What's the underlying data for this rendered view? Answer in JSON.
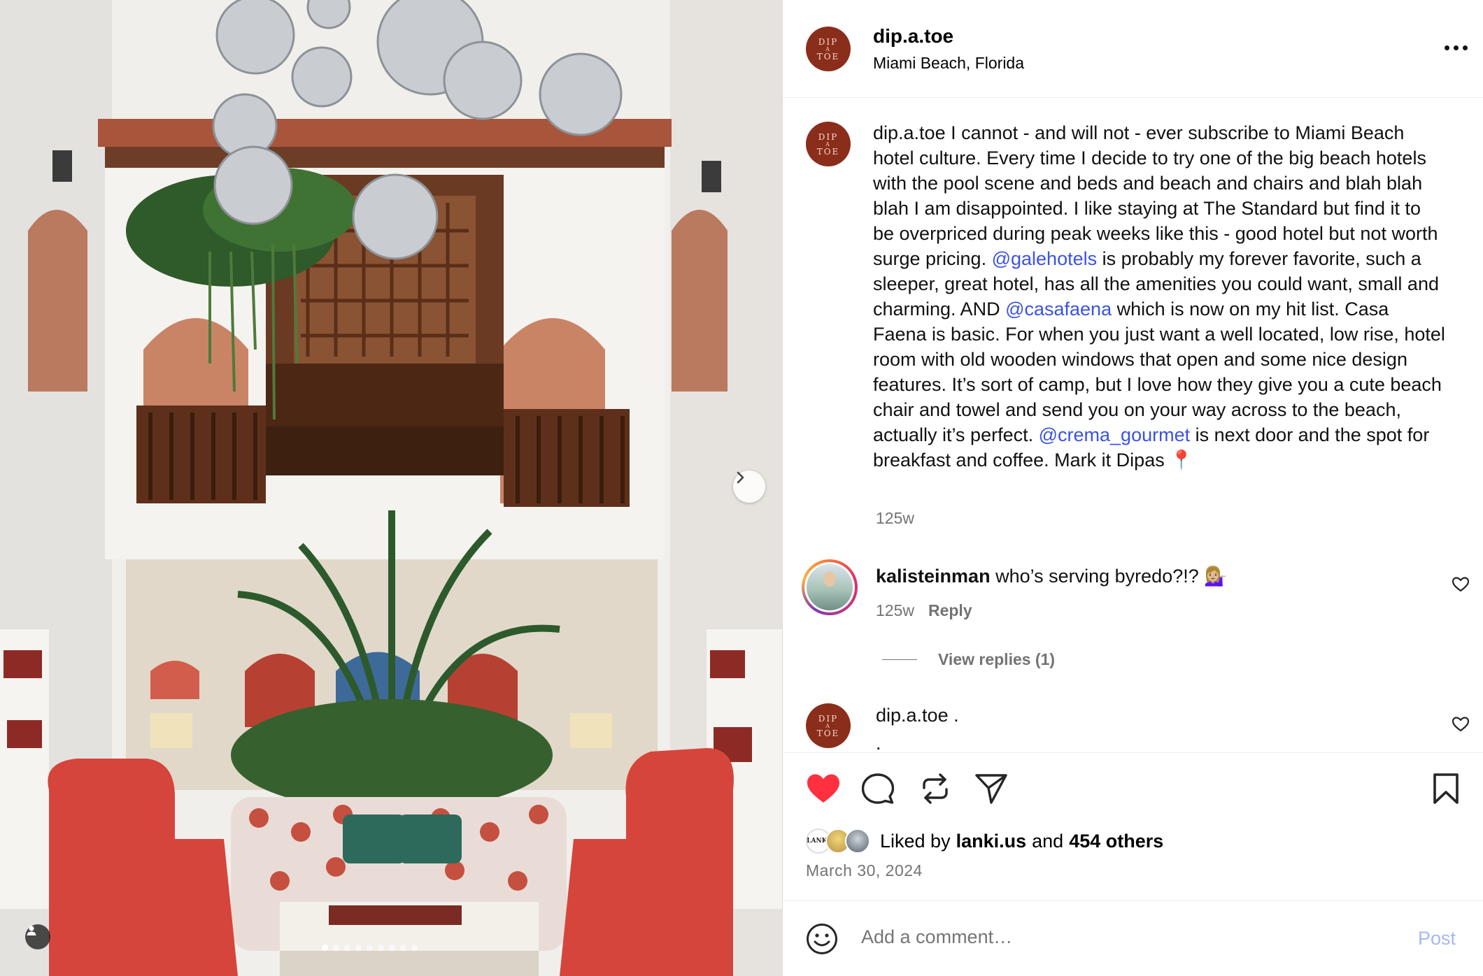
{
  "post": {
    "username": "dip.a.toe",
    "location": "Miami Beach, Florida",
    "avatar_text": [
      "DIP",
      "A",
      "TOE"
    ],
    "image_count": 9,
    "active_image": 1
  },
  "caption": {
    "username": "dip.a.toe",
    "part1": " I cannot - and will not - ever subscribe to Miami Beach hotel culture. Every time I decide to try one of the big beach hotels with the pool scene and beds and beach and chairs and blah blah blah I am disappointed. I like staying at The Standard but find it to be overpriced during peak weeks like this - good hotel but not worth surge pricing. ",
    "mention1": "@galehotels",
    "part2": " is probably my forever favorite, such a sleeper, great hotel, has all the amenities you could want, small and charming. AND ",
    "mention2": "@casafaena",
    "part3": " which is now on my hit list. Casa Faena is basic. For when you just want a well located, low rise, hotel room with old wooden windows that open and some nice design features. It’s sort of camp, but I love how they give you a cute beach chair and towel and send you on your way across to the beach, actually it’s perfect. ",
    "mention3": "@crema_gourmet",
    "part4": " is next door and the spot for breakfast and coffee. Mark it Dipas 📍",
    "time": "125w"
  },
  "comments": [
    {
      "username": "kalisteinman",
      "text": " who’s serving byredo?!? 💁🏼‍♀️",
      "time": "125w",
      "reply_label": "Reply",
      "view_replies": "View replies (1)"
    },
    {
      "username": "dip.a.toe",
      "text": " .",
      "second_line": "."
    }
  ],
  "likes": {
    "prefix": "Liked by",
    "user": "lanki.us",
    "and": "and",
    "others": "454 others",
    "avatar_label": "LANKI"
  },
  "date": "March 30, 2024",
  "add_comment": {
    "placeholder": "Add a comment…",
    "post_label": "Post"
  },
  "colors": {
    "like_red": "#ff3040",
    "mention_blue": "#3a52e6",
    "avatar_brown": "#8b2d1b",
    "post_disabled": "#a5b8f5"
  }
}
